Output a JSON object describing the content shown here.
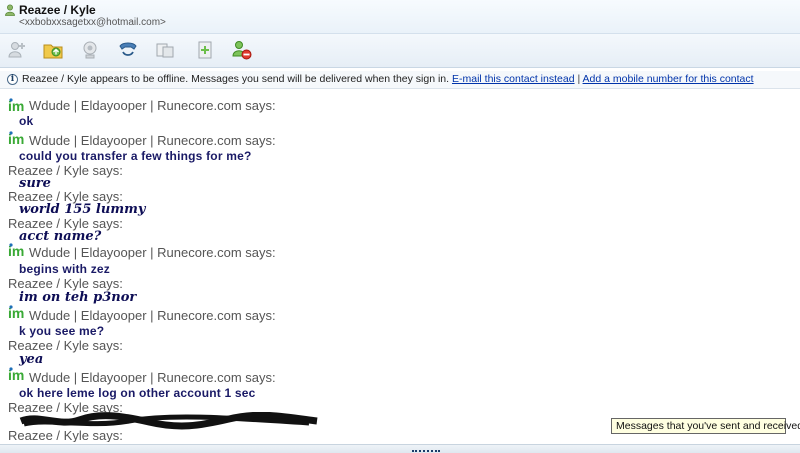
{
  "window": {
    "contact_name": "Reazee / Kyle",
    "contact_email": "<xxbobxxsagetxx@hotmail.com>"
  },
  "toolbar": {
    "buttons": [
      {
        "icon": "invite-contact-icon"
      },
      {
        "icon": "send-files-icon"
      },
      {
        "icon": "webcam-icon"
      },
      {
        "icon": "call-icon"
      },
      {
        "icon": "share-folder-icon"
      },
      {
        "icon": "activities-icon"
      },
      {
        "icon": "block-contact-icon"
      }
    ]
  },
  "infobar": {
    "message": "Reazee / Kyle appears to be offline. Messages you send will be delivered when they sign in.",
    "link_email": "E-mail this contact instead",
    "separator": "|",
    "link_mobile": "Add a mobile number for this contact"
  },
  "conversation": [
    {
      "sender": "Wdude | Eldayooper | Runecore.com says:",
      "text": "ok",
      "self": true
    },
    {
      "sender": "Wdude | Eldayooper | Runecore.com says:",
      "text": "could you transfer a few things for me?",
      "self": true
    },
    {
      "sender": "Reazee / Kyle says:",
      "text": "sure",
      "self": false
    },
    {
      "sender": "Reazee / Kyle says:",
      "text": "world 155 lummy",
      "self": false
    },
    {
      "sender": "Reazee / Kyle says:",
      "text": "acct name?",
      "self": false
    },
    {
      "sender": "Wdude | Eldayooper | Runecore.com says:",
      "text": "begins with zez",
      "self": true
    },
    {
      "sender": "Reazee / Kyle says:",
      "text": "im on teh p3nor",
      "self": false
    },
    {
      "sender": "Wdude | Eldayooper | Runecore.com says:",
      "text": "k you see me?",
      "self": true
    },
    {
      "sender": "Reazee / Kyle says:",
      "text": "yea",
      "self": false
    },
    {
      "sender": "Wdude | Eldayooper | Runecore.com says:",
      "text": "ok here leme log on other account 1 sec",
      "self": true
    },
    {
      "sender": "Reazee / Kyle says:",
      "text": "",
      "self": false
    },
    {
      "sender": "Reazee / Kyle says:",
      "text": "",
      "self": false
    }
  ],
  "tooltip": "Messages that you've sent and received"
}
